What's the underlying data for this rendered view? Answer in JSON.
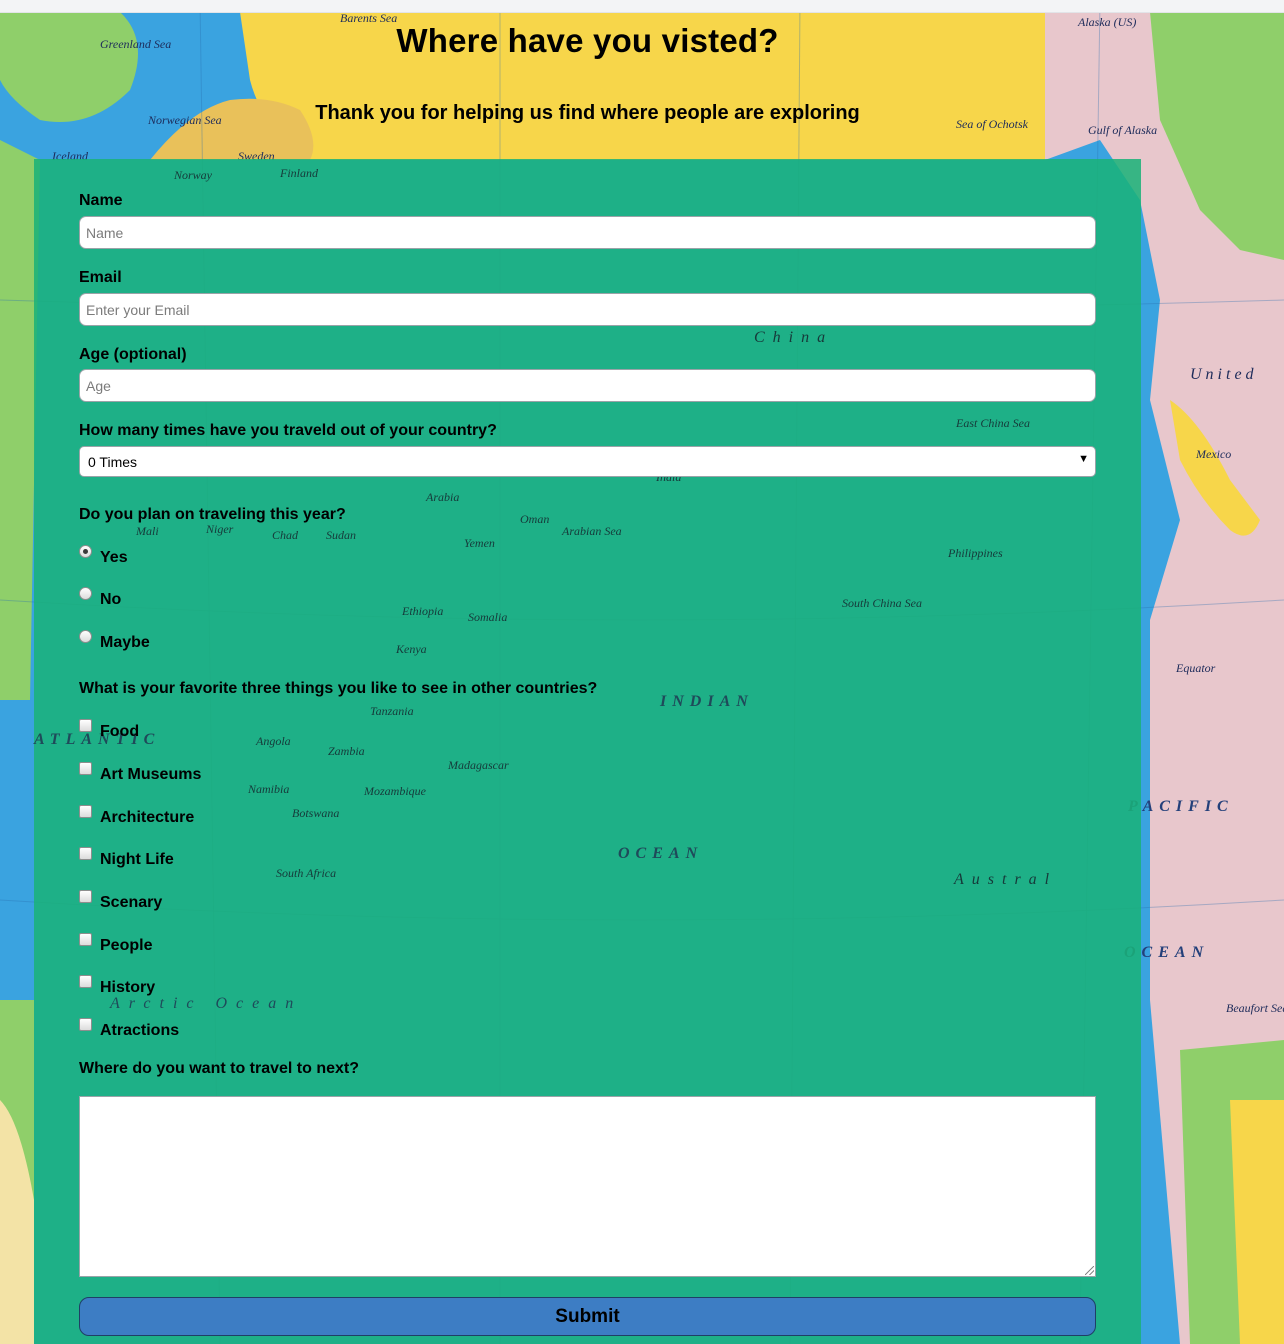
{
  "header": {
    "title": "Where have you visted?",
    "subtitle": "Thank you for helping us find where people are exploring"
  },
  "map": {
    "labels": [
      "Barents Sea",
      "Greenland Sea",
      "Norwegian Sea",
      "Iceland",
      "Sweden",
      "Norway",
      "Finland",
      "Sea of Ochotsk",
      "Alaska (US)",
      "Gulf of Alaska",
      "China",
      "India",
      "Arabia",
      "Oman",
      "Arabian Sea",
      "Yemen",
      "Sudan",
      "Chad",
      "Niger",
      "Mali",
      "Ethiopia",
      "Somalia",
      "Kenya",
      "Tanzania",
      "Angola",
      "Zambia",
      "Namibia",
      "Botswana",
      "Mozambique",
      "Madagascar",
      "South Africa",
      "East China Sea",
      "Philippines",
      "South China Sea",
      "Mexico",
      "United",
      "Equator",
      "Beaufort Sea",
      "Austral"
    ],
    "oceans": [
      "INDIAN",
      "OCEAN",
      "ATLANTIC",
      "PACIFIC",
      "OCEAN",
      "Arctic Ocean"
    ],
    "colors": {
      "water": "#3aa3e0",
      "land_yellow": "#f7d64a",
      "land_pink": "#e8c7cc",
      "land_green": "#8fcf6a",
      "panel": "#1ab278"
    }
  },
  "form": {
    "name": {
      "label": "Name",
      "placeholder": "Name"
    },
    "email": {
      "label": "Email",
      "placeholder": "Enter your Email"
    },
    "age": {
      "label": "Age (optional)",
      "placeholder": "Age"
    },
    "travel_count": {
      "label": "How many times have you traveld out of your country?",
      "selected": "0 Times"
    },
    "plan": {
      "label": "Do you plan on traveling this year?",
      "options": [
        {
          "label": "Yes",
          "checked": true
        },
        {
          "label": "No",
          "checked": false
        },
        {
          "label": "Maybe",
          "checked": false
        }
      ]
    },
    "favorites": {
      "label": "What is your favorite three things you like to see in other countries?",
      "options": [
        "Food",
        "Art Museums",
        "Architecture",
        "Night Life",
        "Scenary",
        "People",
        "History",
        "Atractions"
      ]
    },
    "next": {
      "label": "Where do you want to travel to next?",
      "value": ""
    },
    "submit_label": "Submit"
  }
}
